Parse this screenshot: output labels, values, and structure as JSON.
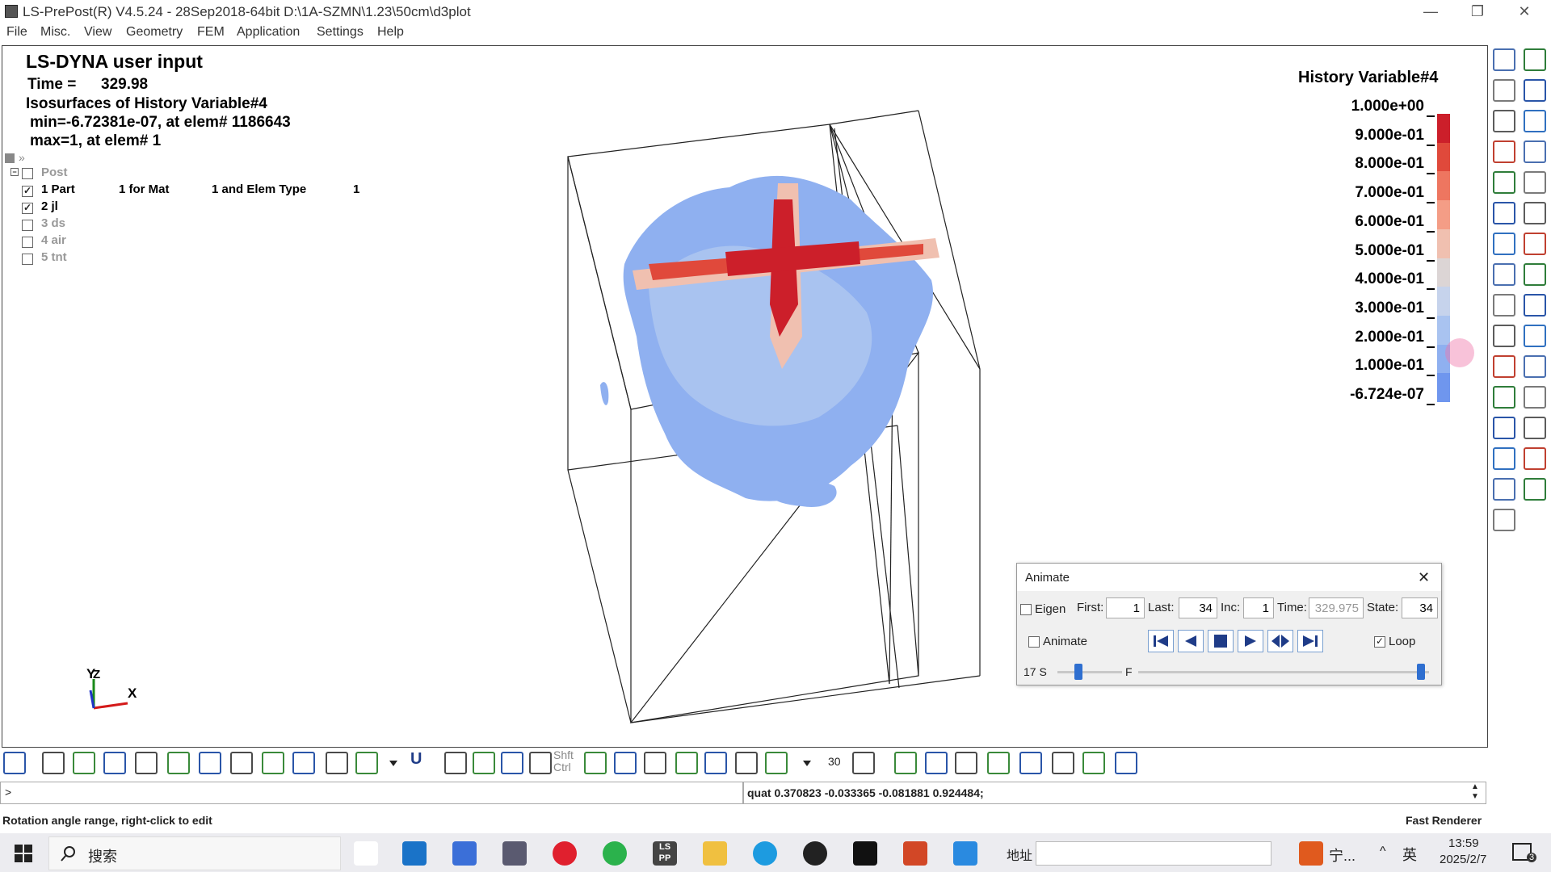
{
  "window": {
    "title": "LS-PrePost(R) V4.5.24 - 28Sep2018-64bit D:\\1A-SZMN\\1.23\\50cm\\d3plot",
    "minimize": "—",
    "restore": "❐",
    "close": "✕"
  },
  "menu": [
    "File",
    "Misc.",
    "View",
    "Geometry",
    "FEM",
    "Application",
    "Settings",
    "Help"
  ],
  "viewport": {
    "heading": "LS-DYNA user input",
    "time_label": "Time =",
    "time_value": "329.98",
    "isosurface_line": "Isosurfaces of History Variable#4",
    "min_line": "min=-6.72381e-07, at elem# 1186643",
    "max_line": "max=1, at elem# 1",
    "tree_root": "Post",
    "parts": [
      {
        "label": "1 Part",
        "mat": "1 for Mat",
        "elem": "1 and Elem Type",
        "num": "1",
        "checked": true
      },
      {
        "label": "2 jl",
        "checked": true
      },
      {
        "label": "3 ds",
        "checked": false
      },
      {
        "label": "4 air",
        "checked": false
      },
      {
        "label": "5 tnt",
        "checked": false
      }
    ],
    "axis_y": "Y",
    "axis_z": "Z",
    "axis_x": "X"
  },
  "legend": {
    "title": "History Variable#4",
    "labels": [
      "1.000e+00",
      "9.000e-01",
      "8.000e-01",
      "7.000e-01",
      "6.000e-01",
      "5.000e-01",
      "4.000e-01",
      "3.000e-01",
      "2.000e-01",
      "1.000e-01",
      "-6.724e-07"
    ],
    "colors": [
      "#cc1f2a",
      "#e0493b",
      "#ee7660",
      "#f49d86",
      "#f0c0b0",
      "#dcd5d5",
      "#c6d3ec",
      "#a9c3f0",
      "#8fb0f0",
      "#6f96ee"
    ]
  },
  "animate": {
    "title": "Animate",
    "close": "✕",
    "eigen_label": "Eigen",
    "first_label": "First:",
    "first_value": "1",
    "last_label": "Last:",
    "last_value": "34",
    "inc_label": "Inc:",
    "inc_value": "1",
    "time_label": "Time:",
    "time_value": "329.975",
    "state_label": "State:",
    "state_value": "34",
    "animate_label": "Animate",
    "loop_label": "Loop",
    "loop_checked": true,
    "speed_label": "17 S",
    "frame_label": "F",
    "speed_level": 0.33,
    "frame_level": 1.0
  },
  "bottom_toolbar": {
    "label_30": "30",
    "label_shft": "Shft",
    "label_ctrl": "Ctrl",
    "label_u": "U"
  },
  "command": {
    "prompt": ">",
    "quat": "quat 0.370823 -0.033365 -0.081881 0.924484;"
  },
  "status": {
    "left": "Rotation angle range, right-click to edit",
    "right": "Fast Renderer"
  },
  "taskbar": {
    "search_label": "搜索",
    "address_label": "地址",
    "ime_text": "宁...",
    "lang": "英",
    "time": "13:59",
    "date": "2025/2/7",
    "notifications": "3",
    "lsprepost_icon_text": "LS PP"
  }
}
